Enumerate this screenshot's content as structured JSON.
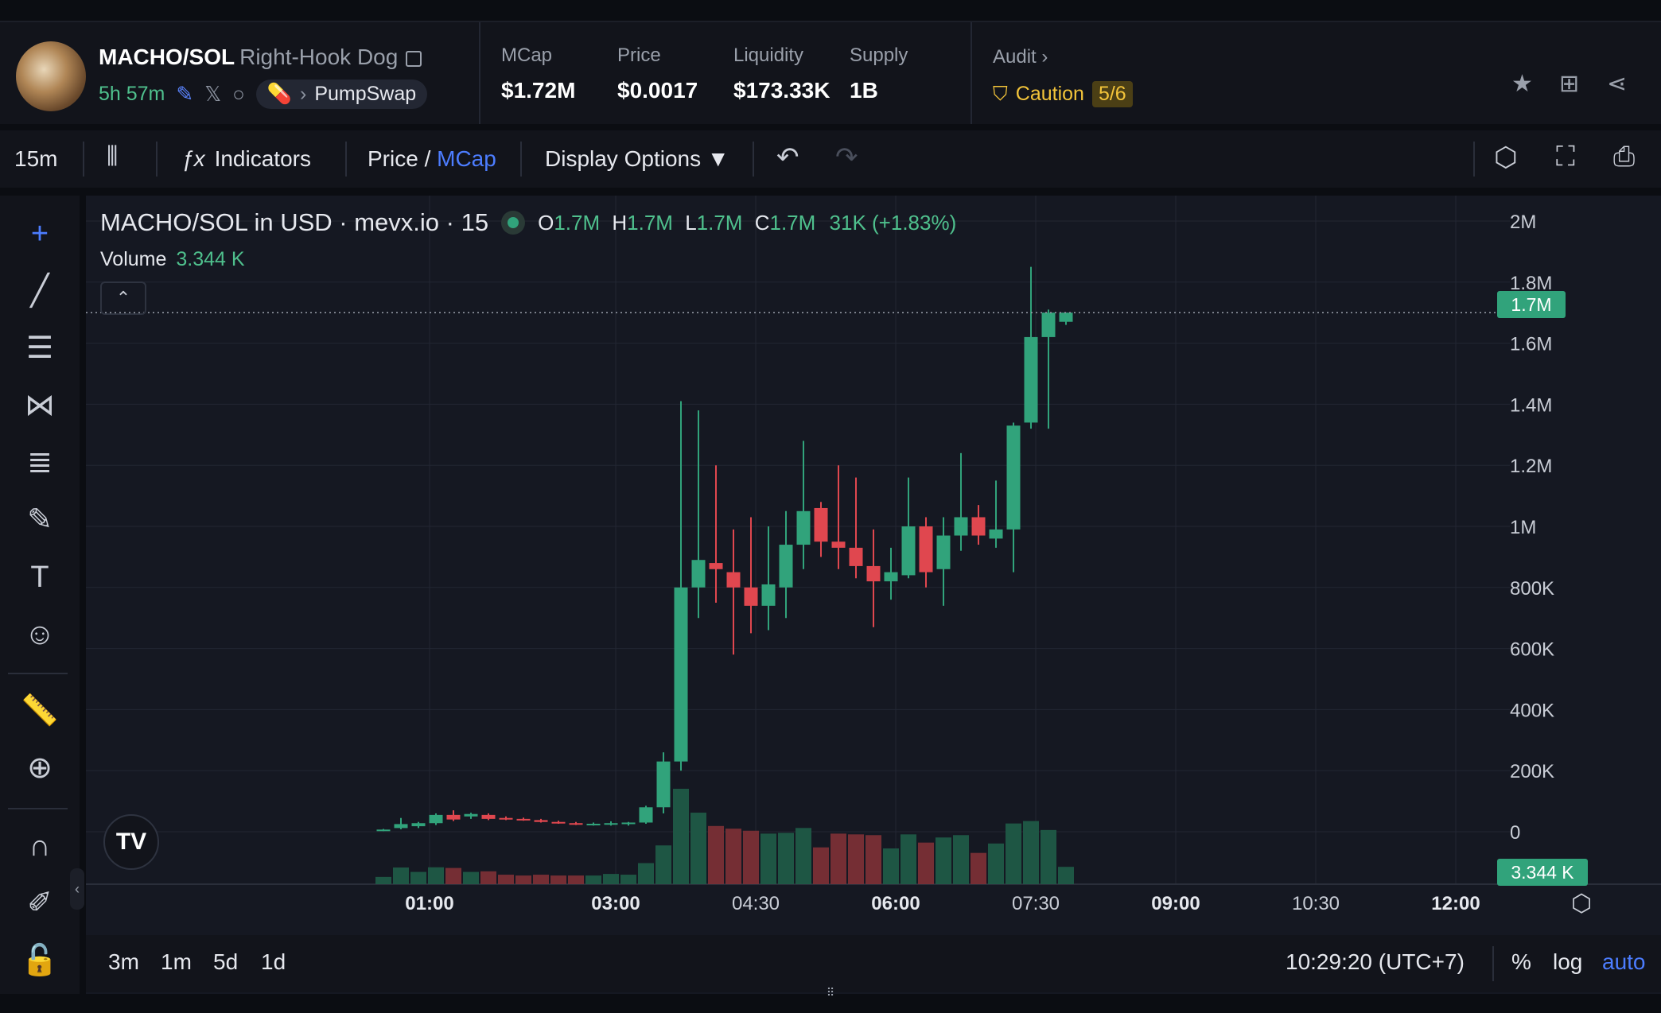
{
  "header": {
    "pair": "MACHO/SOL",
    "token_name": "Right-Hook Dog",
    "age": "5h 57m",
    "dex": "PumpSwap",
    "stats": [
      {
        "label": "MCap",
        "value": "$1.72M"
      },
      {
        "label": "Price",
        "value": "$0.0017"
      },
      {
        "label": "Liquidity",
        "value": "$173.33K"
      },
      {
        "label": "Supply",
        "value": "1B"
      }
    ],
    "audit_label": "Audit",
    "caution_label": "Caution",
    "caution_score": "5/6"
  },
  "toolbar": {
    "interval": "15m",
    "indicators": "Indicators",
    "price_label": "Price",
    "slash": "/",
    "mcap_label": "MCap",
    "display_options": "Display Options ▼"
  },
  "legend": {
    "title": "MACHO/SOL in USD · mevx.io · 15",
    "o_label": "O",
    "o": "1.7M",
    "h_label": "H",
    "h": "1.7M",
    "l_label": "L",
    "l": "1.7M",
    "c_label": "C",
    "c": "1.7M",
    "change": "31K (+1.83%)",
    "volume_label": "Volume",
    "volume_value": "3.344 K"
  },
  "price_tags": {
    "last_price": "1.7M",
    "last_volume": "3.344 K"
  },
  "bottombar": {
    "ranges": [
      "3m",
      "1m",
      "5d",
      "1d"
    ],
    "clock": "10:29:20 (UTC+7)",
    "percent": "%",
    "log": "log",
    "auto": "auto"
  },
  "colors": {
    "up": "#31a37b",
    "down": "#e0474f",
    "accent": "#4c7dff",
    "background": "#151822"
  },
  "chart_data": {
    "type": "candlestick",
    "interval": "15m",
    "y_ticks": [
      "2M",
      "1.8M",
      "1.6M",
      "1.4M",
      "1.2M",
      "1M",
      "800K",
      "600K",
      "400K",
      "200K",
      "0"
    ],
    "x_ticks": [
      "01:00",
      "03:00",
      "04:30",
      "06:00",
      "07:30",
      "09:00",
      "10:30",
      "12:00"
    ],
    "ylim": [
      0,
      2000000
    ],
    "last_price": 1700000,
    "candles": [
      {
        "o": 5000,
        "h": 9000,
        "l": 2000,
        "c": 7000
      },
      {
        "o": 12000,
        "h": 45000,
        "l": 8000,
        "c": 25000
      },
      {
        "o": 18000,
        "h": 32000,
        "l": 12000,
        "c": 28000
      },
      {
        "o": 28000,
        "h": 60000,
        "l": 22000,
        "c": 55000
      },
      {
        "o": 55000,
        "h": 70000,
        "l": 35000,
        "c": 40000
      },
      {
        "o": 50000,
        "h": 62000,
        "l": 42000,
        "c": 58000
      },
      {
        "o": 55000,
        "h": 60000,
        "l": 38000,
        "c": 42000
      },
      {
        "o": 45000,
        "h": 50000,
        "l": 38000,
        "c": 40000
      },
      {
        "o": 42000,
        "h": 46000,
        "l": 36000,
        "c": 38000
      },
      {
        "o": 38000,
        "h": 42000,
        "l": 30000,
        "c": 32000
      },
      {
        "o": 32000,
        "h": 36000,
        "l": 26000,
        "c": 28000
      },
      {
        "o": 28000,
        "h": 32000,
        "l": 22000,
        "c": 25000
      },
      {
        "o": 25000,
        "h": 30000,
        "l": 20000,
        "c": 26000
      },
      {
        "o": 26000,
        "h": 34000,
        "l": 20000,
        "c": 28000
      },
      {
        "o": 26000,
        "h": 32000,
        "l": 20000,
        "c": 30000
      },
      {
        "o": 30000,
        "h": 85000,
        "l": 26000,
        "c": 80000
      },
      {
        "o": 80000,
        "h": 260000,
        "l": 60000,
        "c": 230000
      },
      {
        "o": 230000,
        "h": 1410000,
        "l": 200000,
        "c": 800000
      },
      {
        "o": 800000,
        "h": 1380000,
        "l": 700000,
        "c": 890000
      },
      {
        "o": 880000,
        "h": 1200000,
        "l": 750000,
        "c": 860000
      },
      {
        "o": 850000,
        "h": 990000,
        "l": 580000,
        "c": 800000
      },
      {
        "o": 800000,
        "h": 1030000,
        "l": 650000,
        "c": 740000
      },
      {
        "o": 740000,
        "h": 1000000,
        "l": 660000,
        "c": 810000
      },
      {
        "o": 800000,
        "h": 1050000,
        "l": 700000,
        "c": 940000
      },
      {
        "o": 940000,
        "h": 1280000,
        "l": 860000,
        "c": 1050000
      },
      {
        "o": 1060000,
        "h": 1080000,
        "l": 900000,
        "c": 950000
      },
      {
        "o": 950000,
        "h": 1200000,
        "l": 860000,
        "c": 930000
      },
      {
        "o": 930000,
        "h": 1160000,
        "l": 830000,
        "c": 870000
      },
      {
        "o": 870000,
        "h": 990000,
        "l": 670000,
        "c": 820000
      },
      {
        "o": 820000,
        "h": 930000,
        "l": 760000,
        "c": 850000
      },
      {
        "o": 840000,
        "h": 1160000,
        "l": 830000,
        "c": 1000000
      },
      {
        "o": 1000000,
        "h": 1030000,
        "l": 800000,
        "c": 850000
      },
      {
        "o": 860000,
        "h": 1030000,
        "l": 740000,
        "c": 970000
      },
      {
        "o": 970000,
        "h": 1240000,
        "l": 920000,
        "c": 1030000
      },
      {
        "o": 1030000,
        "h": 1070000,
        "l": 940000,
        "c": 970000
      },
      {
        "o": 960000,
        "h": 1150000,
        "l": 930000,
        "c": 990000
      },
      {
        "o": 990000,
        "h": 1340000,
        "l": 850000,
        "c": 1330000
      },
      {
        "o": 1340000,
        "h": 1850000,
        "l": 1320000,
        "c": 1620000
      },
      {
        "o": 1620000,
        "h": 1710000,
        "l": 1320000,
        "c": 1700000
      },
      {
        "o": 1670000,
        "h": 1700000,
        "l": 1660000,
        "c": 1700000
      }
    ],
    "volume_max_label": "3.344 K"
  }
}
